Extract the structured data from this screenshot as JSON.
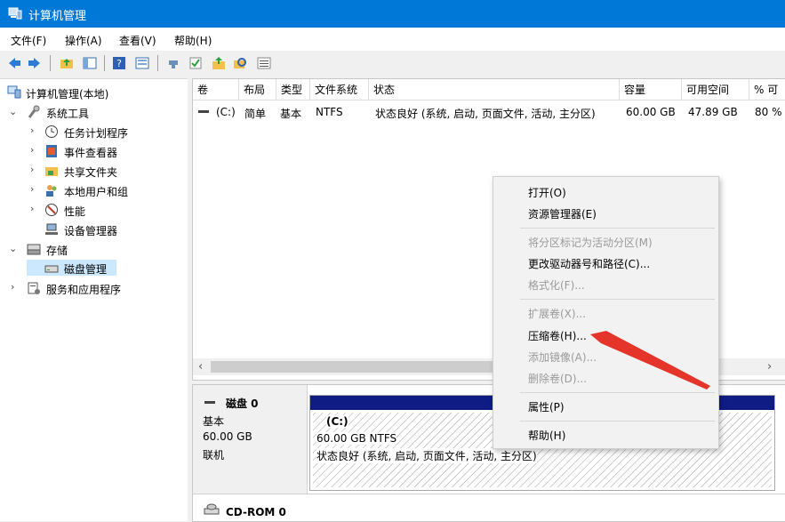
{
  "window": {
    "title": "计算机管理"
  },
  "menubar": {
    "items": [
      "文件(F)",
      "操作(A)",
      "查看(V)",
      "帮助(H)"
    ]
  },
  "tree": {
    "root": "计算机管理(本地)",
    "system_tools": "系统工具",
    "task_scheduler": "任务计划程序",
    "event_viewer": "事件查看器",
    "shared_folders": "共享文件夹",
    "local_users": "本地用户和组",
    "performance": "性能",
    "device_manager": "设备管理器",
    "storage": "存储",
    "disk_management": "磁盘管理",
    "services_apps": "服务和应用程序"
  },
  "volume_list": {
    "columns": [
      "卷",
      "布局",
      "类型",
      "文件系统",
      "状态",
      "容量",
      "可用空间",
      "% 可"
    ],
    "row": {
      "volume": "(C:)",
      "layout": "简单",
      "type": "基本",
      "filesystem": "NTFS",
      "status": "状态良好 (系统, 启动, 页面文件, 活动, 主分区)",
      "capacity": "60.00 GB",
      "free": "47.89 GB",
      "percent": "80 %"
    }
  },
  "disks": {
    "disk0": {
      "name": "磁盘 0",
      "type": "基本",
      "size": "60.00 GB",
      "state": "联机",
      "partition": {
        "label": "(C:)",
        "size_fs": "60.00 GB NTFS",
        "status": "状态良好 (系统, 启动, 页面文件, 活动, 主分区)"
      }
    },
    "cdrom0": {
      "name": "CD-ROM 0"
    }
  },
  "context_menu": {
    "open": "打开(O)",
    "explorer": "资源管理器(E)",
    "mark_active": "将分区标记为活动分区(M)",
    "change_letter": "更改驱动器号和路径(C)...",
    "format": "格式化(F)...",
    "extend": "扩展卷(X)...",
    "shrink": "压缩卷(H)...",
    "add_mirror": "添加镜像(A)...",
    "delete": "删除卷(D)...",
    "properties": "属性(P)",
    "help": "帮助(H)"
  },
  "colors": {
    "titlebar": "#0078d7",
    "partition_header": "#0f1c84",
    "annotation_arrow": "#e5342a"
  }
}
